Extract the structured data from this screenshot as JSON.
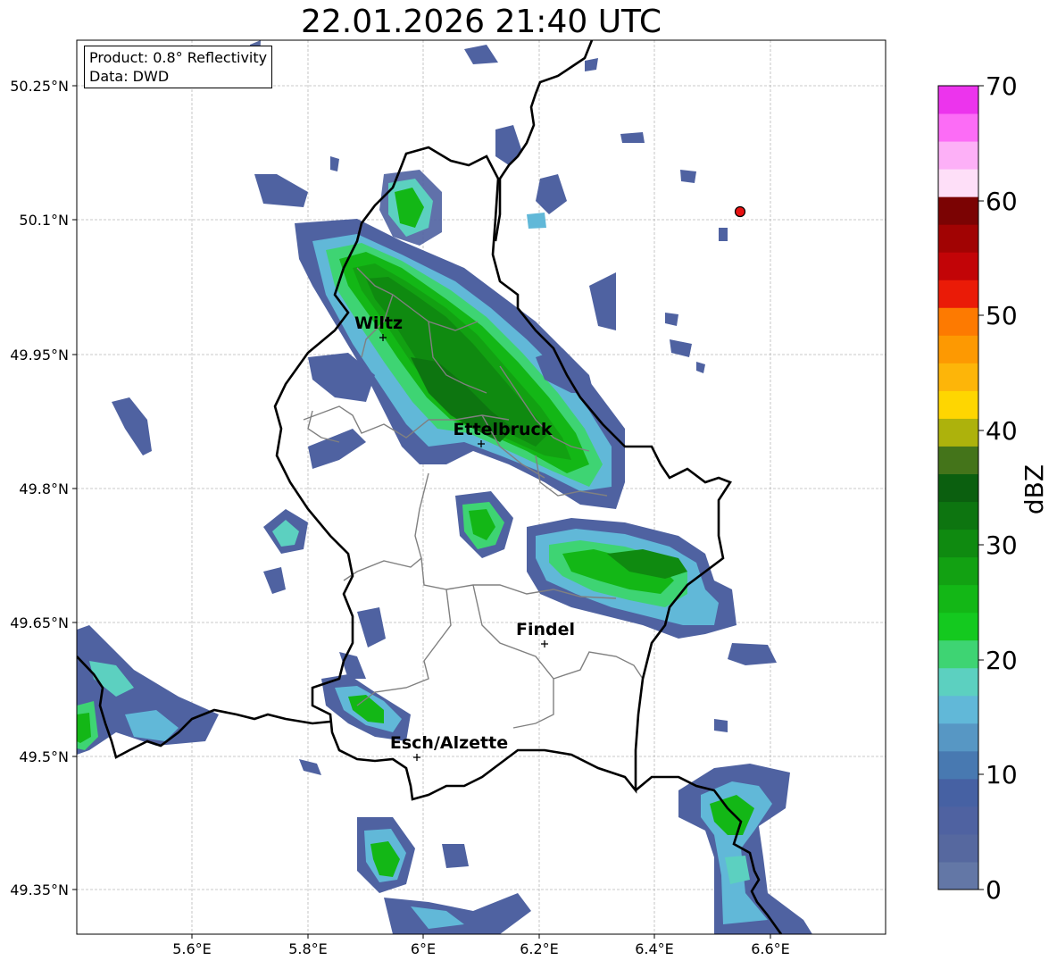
{
  "title": "22.01.2026 21:40 UTC",
  "info": {
    "product": "Product: 0.8° Reflectivity",
    "data": "Data: DWD"
  },
  "axes": {
    "lon_ticks": [
      "5.6°E",
      "5.8°E",
      "6°E",
      "6.2°E",
      "6.4°E",
      "6.6°E"
    ],
    "lat_ticks": [
      "50.25°N",
      "50.1°N",
      "49.95°N",
      "49.8°N",
      "49.65°N",
      "49.5°N",
      "49.35°N"
    ]
  },
  "places": [
    {
      "name": "Wiltz"
    },
    {
      "name": "Ettelbruck"
    },
    {
      "name": "Findel"
    },
    {
      "name": "Esch/Alzette"
    }
  ],
  "colorbar": {
    "label": "dBZ",
    "ticks": [
      "0",
      "10",
      "20",
      "30",
      "40",
      "50",
      "60",
      "70"
    ],
    "colors": [
      "#6377a6",
      "#56689f",
      "#4f62a1",
      "#4661a3",
      "#4879b1",
      "#5797c4",
      "#61b8d8",
      "#5cd0c0",
      "#3ed473",
      "#14c91f",
      "#13b716",
      "#12a112",
      "#0f8a10",
      "#0d7510",
      "#0b5f0f",
      "#44741a",
      "#adb20c",
      "#fed601",
      "#fdb509",
      "#fd9902",
      "#fd7a01",
      "#ea1b07",
      "#c20407",
      "#a10303",
      "#7b0303",
      "#fedff8",
      "#fdb0f7",
      "#fc6cf6",
      "#ec34ed"
    ]
  },
  "chart_data": {
    "type": "heatmap",
    "title": "22.01.2026 21:40 UTC",
    "xlabel": "",
    "ylabel": "",
    "x_ticks": [
      "5.6°E",
      "5.8°E",
      "6°E",
      "6.2°E",
      "6.4°E",
      "6.6°E"
    ],
    "y_ticks": [
      "50.25°N",
      "50.1°N",
      "49.95°N",
      "49.8°N",
      "49.65°N",
      "49.5°N",
      "49.35°N"
    ],
    "colorbar_label": "dBZ",
    "colorbar_range": [
      0,
      70
    ],
    "colorbar_ticks": [
      0,
      10,
      20,
      30,
      40,
      50,
      60,
      70
    ]
  }
}
